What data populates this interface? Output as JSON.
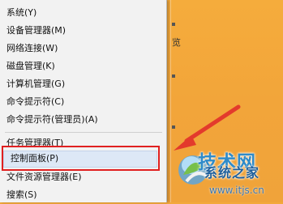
{
  "menu": {
    "items": [
      {
        "label": "系统(Y)"
      },
      {
        "label": "设备管理器(M)"
      },
      {
        "label": "网络连接(W)"
      },
      {
        "label": "磁盘管理(K)"
      },
      {
        "label": "计算机管理(G)"
      },
      {
        "label": "命令提示符(C)"
      },
      {
        "label": "命令提示符(管理员)(A)"
      },
      {
        "label": "任务管理器(T)"
      },
      {
        "label": "控制面板(P)"
      },
      {
        "label": "文件资源管理器(E)"
      },
      {
        "label": "搜索(S)"
      }
    ],
    "highlighted_index": 8
  },
  "desktop": {
    "text_fragment": "览"
  },
  "watermark": {
    "logo_text": "技术网",
    "logo_sub": "系统之家",
    "url": "www.itjs.cn"
  },
  "colors": {
    "desktop_orange": "#f2a53a",
    "menu_background": "#f2f2f2",
    "annotation_red": "#e02020",
    "highlight_blue": "#dde8f6",
    "watermark_blue": "#2f8bc9"
  },
  "icons": [
    "arrow-annotation-icon",
    "watermark-logo-icon"
  ]
}
